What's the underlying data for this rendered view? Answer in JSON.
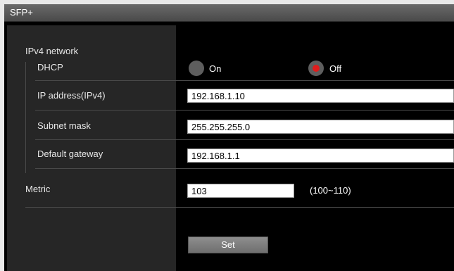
{
  "panel": {
    "title": "SFP+"
  },
  "ipv4": {
    "section_label": "IPv4 network",
    "dhcp": {
      "label": "DHCP",
      "options": [
        "On",
        "Off"
      ],
      "selected": "Off"
    },
    "ip_address": {
      "label": "IP address(IPv4)",
      "value": "192.168.1.10"
    },
    "subnet_mask": {
      "label": "Subnet mask",
      "value": "255.255.255.0"
    },
    "default_gateway": {
      "label": "Default gateway",
      "value": "192.168.1.1"
    }
  },
  "metric": {
    "label": "Metric",
    "value": "103",
    "range": "(100~110)"
  },
  "actions": {
    "set_label": "Set"
  },
  "colors": {
    "radio_selected": "#e01c1c",
    "background": "#000000",
    "label_pane": "#262626"
  }
}
